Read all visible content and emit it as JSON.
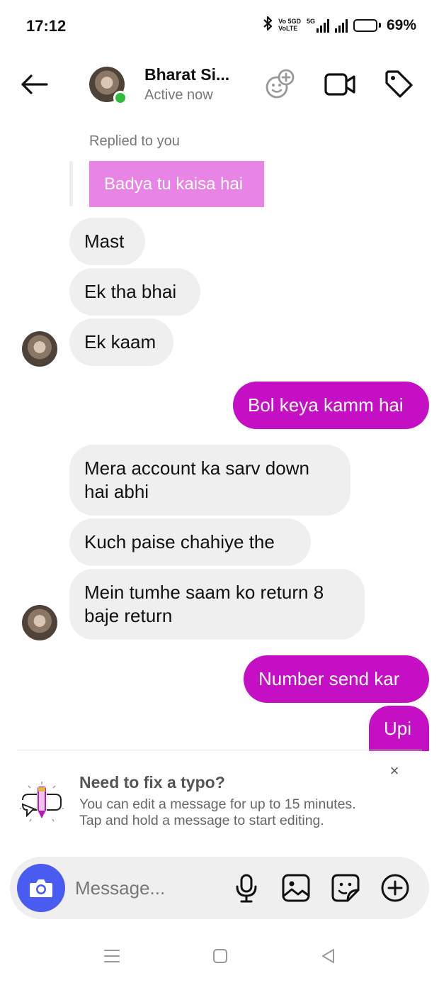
{
  "status_bar": {
    "time": "17:12",
    "network_label_1": "Vo 5GD",
    "network_label_2": "VoLTE",
    "network_5g": "5G",
    "battery_percent": "69%",
    "battery_level": 0.69,
    "icons": [
      "bluetooth-icon",
      "signal-icon",
      "signal-icon",
      "battery-icon"
    ]
  },
  "header": {
    "contact_name": "Bharat Si...",
    "status": "Active now",
    "icons": [
      "back-arrow-icon",
      "add-effects-icon",
      "video-call-icon",
      "tag-icon"
    ]
  },
  "messages": {
    "replied_label": "Replied to you",
    "reply_quote": "Badya tu kaisa hai",
    "m1": "Mast",
    "m2": "Ek tha bhai",
    "m3": "Ek kaam",
    "m4": "Bol keya kamm hai",
    "m5": "Mera account ka sarv down hai abhi",
    "m6": "Kuch paise chahiye the",
    "m7": "Mein tumhe saam ko return 8 baje return",
    "m8": "Number send kar",
    "m9": "Upi"
  },
  "tip": {
    "title": "Need to fix a typo?",
    "body": "You can edit a message for up to 15 minutes. Tap and hold a message to start editing.",
    "close": "×"
  },
  "composer": {
    "placeholder": "Message...",
    "icons": [
      "camera-icon",
      "microphone-icon",
      "gallery-icon",
      "sticker-icon",
      "plus-circle-icon"
    ]
  },
  "colors": {
    "outgoing_bubble": "#c50fc5",
    "incoming_bubble": "#efefef",
    "reply_bubble": "#e784e5",
    "camera_button": "#4a5bf1",
    "online_dot": "#2fbd3b"
  }
}
